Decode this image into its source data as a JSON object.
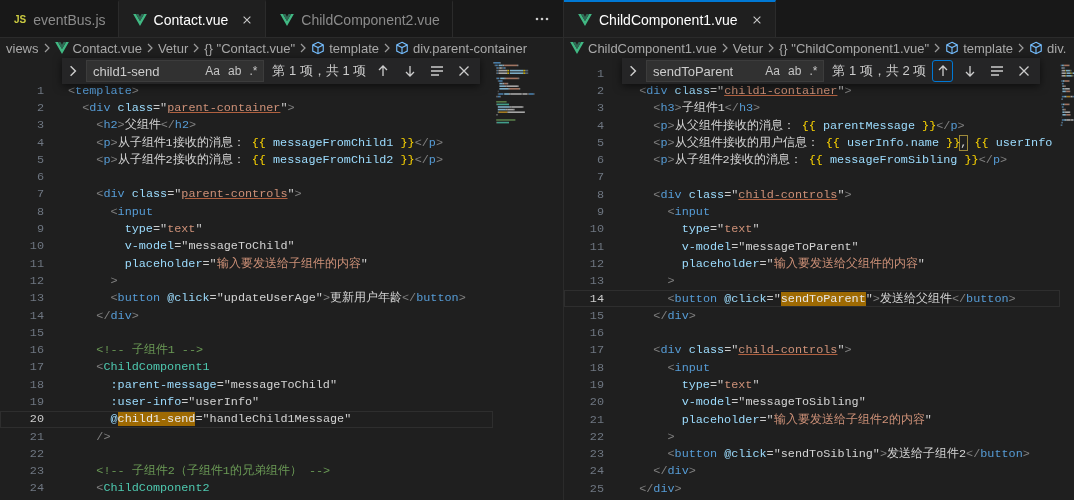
{
  "panes": [
    {
      "tabs": [
        {
          "label": "eventBus.js",
          "kind": "js",
          "icon_text": "JS",
          "selected": false
        },
        {
          "label": "Contact.vue",
          "kind": "vue",
          "selected": true
        },
        {
          "label": "ChildComponent2.vue",
          "kind": "vue",
          "selected": false
        }
      ],
      "breadcrumbs": [
        {
          "label": "views",
          "kind": "folder"
        },
        {
          "label": "Contact.vue",
          "kind": "file"
        },
        {
          "label": "Vetur",
          "kind": "text"
        },
        {
          "label": "{} \"Contact.vue\"",
          "kind": "object"
        },
        {
          "label": "template",
          "kind": "symbol"
        },
        {
          "label": "div.parent-container",
          "kind": "symbol"
        }
      ],
      "find": {
        "query": "child1-send",
        "toggles": [
          "Aa",
          "ab",
          ".*"
        ],
        "result": "第 1 项，共 1 项",
        "buttons": [
          {
            "kind": "previous",
            "focused": false
          },
          {
            "kind": "next",
            "focused": false
          },
          {
            "kind": "selection",
            "focused": false
          },
          {
            "kind": "close",
            "focused": false
          }
        ]
      },
      "lines": [
        {
          "number": "1",
          "current": false,
          "tokens": [
            {
              "kind": "p",
              "text": "<"
            },
            {
              "kind": "tag",
              "text": "template"
            },
            {
              "kind": "p",
              "text": ">"
            }
          ]
        },
        {
          "number": "2",
          "current": false,
          "tokens": [
            {
              "kind": "p",
              "text": "  <"
            },
            {
              "kind": "tag",
              "text": "div"
            },
            {
              "kind": "attr",
              "text": " class"
            },
            {
              "kind": "eq",
              "text": "=\""
            },
            {
              "kind": "cls",
              "text": "parent-container"
            },
            {
              "kind": "eq",
              "text": "\""
            },
            {
              "kind": "p",
              "text": ">"
            }
          ]
        },
        {
          "number": "3",
          "current": false,
          "tokens": [
            {
              "kind": "p",
              "text": "    <"
            },
            {
              "kind": "tag",
              "text": "h2"
            },
            {
              "kind": "p",
              "text": ">"
            },
            {
              "kind": "text",
              "text": "父组件"
            },
            {
              "kind": "p",
              "text": "</"
            },
            {
              "kind": "tag",
              "text": "h2"
            },
            {
              "kind": "p",
              "text": ">"
            }
          ]
        },
        {
          "number": "4",
          "current": false,
          "tokens": [
            {
              "kind": "p",
              "text": "    <"
            },
            {
              "kind": "tag",
              "text": "p"
            },
            {
              "kind": "p",
              "text": ">"
            },
            {
              "kind": "text",
              "text": "从子组件1接收的消息： "
            },
            {
              "kind": "br",
              "text": "{{"
            },
            {
              "kind": "var",
              "text": " messageFromChild1 "
            },
            {
              "kind": "br",
              "text": "}}"
            },
            {
              "kind": "p",
              "text": "</"
            },
            {
              "kind": "tag",
              "text": "p"
            },
            {
              "kind": "p",
              "text": ">"
            }
          ]
        },
        {
          "number": "5",
          "current": false,
          "tokens": [
            {
              "kind": "p",
              "text": "    <"
            },
            {
              "kind": "tag",
              "text": "p"
            },
            {
              "kind": "p",
              "text": ">"
            },
            {
              "kind": "text",
              "text": "从子组件2接收的消息： "
            },
            {
              "kind": "br",
              "text": "{{"
            },
            {
              "kind": "var",
              "text": " messageFromChild2 "
            },
            {
              "kind": "br",
              "text": "}}"
            },
            {
              "kind": "p",
              "text": "</"
            },
            {
              "kind": "tag",
              "text": "p"
            },
            {
              "kind": "p",
              "text": ">"
            }
          ]
        },
        {
          "number": "6",
          "current": false
        },
        {
          "number": "7",
          "current": false,
          "tokens": [
            {
              "kind": "p",
              "text": "    <"
            },
            {
              "kind": "tag",
              "text": "div"
            },
            {
              "kind": "attr",
              "text": " class"
            },
            {
              "kind": "eq",
              "text": "=\""
            },
            {
              "kind": "cls",
              "text": "parent-controls"
            },
            {
              "kind": "eq",
              "text": "\""
            },
            {
              "kind": "p",
              "text": ">"
            }
          ]
        },
        {
          "number": "8",
          "current": false,
          "tokens": [
            {
              "kind": "p",
              "text": "      <"
            },
            {
              "kind": "tag",
              "text": "input"
            }
          ]
        },
        {
          "number": "9",
          "current": false,
          "tokens": [
            {
              "kind": "attr",
              "text": "        type"
            },
            {
              "kind": "eq",
              "text": "=\""
            },
            {
              "kind": "str",
              "text": "text"
            },
            {
              "kind": "eq",
              "text": "\""
            }
          ]
        },
        {
          "number": "10",
          "current": false,
          "tokens": [
            {
              "kind": "attr",
              "text": "        v-model"
            },
            {
              "kind": "eq",
              "text": "=\""
            },
            {
              "kind": "text",
              "text": "messageToChild"
            },
            {
              "kind": "eq",
              "text": "\""
            }
          ]
        },
        {
          "number": "11",
          "current": false,
          "tokens": [
            {
              "kind": "attr",
              "text": "        placeholder"
            },
            {
              "kind": "eq",
              "text": "=\""
            },
            {
              "kind": "str",
              "text": "输入要发送给子组件的内容"
            },
            {
              "kind": "eq",
              "text": "\""
            }
          ]
        },
        {
          "number": "12",
          "current": false,
          "tokens": [
            {
              "kind": "p",
              "text": "      >"
            }
          ]
        },
        {
          "number": "13",
          "current": false,
          "tokens": [
            {
              "kind": "p",
              "text": "      <"
            },
            {
              "kind": "tag",
              "text": "button"
            },
            {
              "kind": "attr",
              "text": " @click"
            },
            {
              "kind": "eq",
              "text": "=\""
            },
            {
              "kind": "text",
              "text": "updateUserAge"
            },
            {
              "kind": "eq",
              "text": "\""
            },
            {
              "kind": "p",
              "text": ">"
            },
            {
              "kind": "text",
              "text": "更新用户年龄"
            },
            {
              "kind": "p",
              "text": "</"
            },
            {
              "kind": "tag",
              "text": "button"
            },
            {
              "kind": "p",
              "text": ">"
            }
          ]
        },
        {
          "number": "14",
          "current": false,
          "tokens": [
            {
              "kind": "p",
              "text": "    </"
            },
            {
              "kind": "tag",
              "text": "div"
            },
            {
              "kind": "p",
              "text": ">"
            }
          ]
        },
        {
          "number": "15",
          "current": false
        },
        {
          "number": "16",
          "current": false,
          "tokens": [
            {
              "kind": "com",
              "text": "    <!-- 子组件1 -->"
            }
          ]
        },
        {
          "number": "17",
          "current": false,
          "tokens": [
            {
              "kind": "p",
              "text": "    <"
            },
            {
              "kind": "comp",
              "text": "ChildComponent1"
            }
          ]
        },
        {
          "number": "18",
          "current": false,
          "tokens": [
            {
              "kind": "attr",
              "text": "      :parent-message"
            },
            {
              "kind": "eq",
              "text": "=\""
            },
            {
              "kind": "text",
              "text": "messageToChild"
            },
            {
              "kind": "eq",
              "text": "\""
            }
          ]
        },
        {
          "number": "19",
          "current": false,
          "tokens": [
            {
              "kind": "attr",
              "text": "      :user-info"
            },
            {
              "kind": "eq",
              "text": "=\""
            },
            {
              "kind": "text",
              "text": "userInfo"
            },
            {
              "kind": "eq",
              "text": "\""
            }
          ]
        },
        {
          "number": "20",
          "current": true,
          "tokens": [
            {
              "kind": "attr",
              "text": "      @"
            },
            {
              "kind": "match",
              "text": "child1-send"
            },
            {
              "kind": "eq",
              "text": "=\""
            },
            {
              "kind": "text",
              "text": "handleChild1Message"
            },
            {
              "kind": "eq",
              "text": "\""
            }
          ]
        },
        {
          "number": "21",
          "current": false,
          "tokens": [
            {
              "kind": "p",
              "text": "    />"
            }
          ]
        },
        {
          "number": "22",
          "current": false
        },
        {
          "number": "23",
          "current": false,
          "tokens": [
            {
              "kind": "com",
              "text": "    <!-- 子组件2（子组件1的兄弟组件） -->"
            }
          ]
        },
        {
          "number": "24",
          "current": false,
          "tokens": [
            {
              "kind": "p",
              "text": "    <"
            },
            {
              "kind": "comp",
              "text": "ChildComponent2"
            }
          ]
        }
      ]
    },
    {
      "tabs": [
        {
          "label": "ChildComponent1.vue",
          "kind": "vue",
          "selected": true
        }
      ],
      "breadcrumbs": [
        {
          "label": "ChildComponent1.vue",
          "kind": "file"
        },
        {
          "label": "Vetur",
          "kind": "text"
        },
        {
          "label": "{} \"ChildComponent1.vue\"",
          "kind": "object"
        },
        {
          "label": "template",
          "kind": "symbol"
        },
        {
          "label": "div.",
          "kind": "symbol"
        }
      ],
      "find": {
        "query": "sendToParent",
        "toggles": [
          "Aa",
          "ab",
          ".*"
        ],
        "result": "第 1 项，共 2 项",
        "buttons": [
          {
            "kind": "previous",
            "focused": true
          },
          {
            "kind": "next",
            "focused": false
          },
          {
            "kind": "selection",
            "focused": false
          },
          {
            "kind": "close",
            "focused": false
          }
        ]
      },
      "lines": [
        {
          "number": "1",
          "current": false
        },
        {
          "number": "2",
          "current": false,
          "tokens": [
            {
              "kind": "p",
              "text": "  <"
            },
            {
              "kind": "tag",
              "text": "div"
            },
            {
              "kind": "attr",
              "text": " class"
            },
            {
              "kind": "eq",
              "text": "=\""
            },
            {
              "kind": "cls",
              "text": "child1-container"
            },
            {
              "kind": "eq",
              "text": "\""
            },
            {
              "kind": "p",
              "text": ">"
            }
          ]
        },
        {
          "number": "3",
          "current": false,
          "tokens": [
            {
              "kind": "p",
              "text": "    <"
            },
            {
              "kind": "tag",
              "text": "h3"
            },
            {
              "kind": "p",
              "text": ">"
            },
            {
              "kind": "text",
              "text": "子组件1"
            },
            {
              "kind": "p",
              "text": "</"
            },
            {
              "kind": "tag",
              "text": "h3"
            },
            {
              "kind": "p",
              "text": ">"
            }
          ]
        },
        {
          "number": "4",
          "current": false,
          "tokens": [
            {
              "kind": "p",
              "text": "    <"
            },
            {
              "kind": "tag",
              "text": "p"
            },
            {
              "kind": "p",
              "text": ">"
            },
            {
              "kind": "text",
              "text": "从父组件接收的消息： "
            },
            {
              "kind": "br",
              "text": "{{"
            },
            {
              "kind": "var",
              "text": " parentMessage "
            },
            {
              "kind": "br",
              "text": "}}"
            },
            {
              "kind": "p",
              "text": "</"
            },
            {
              "kind": "tag",
              "text": "p"
            },
            {
              "kind": "p",
              "text": ">"
            }
          ]
        },
        {
          "number": "5",
          "current": false,
          "tokens": [
            {
              "kind": "p",
              "text": "    <"
            },
            {
              "kind": "tag",
              "text": "p"
            },
            {
              "kind": "p",
              "text": ">"
            },
            {
              "kind": "text",
              "text": "从父组件接收的用户信息： "
            },
            {
              "kind": "br",
              "text": "{{"
            },
            {
              "kind": "var",
              "text": " userInfo.name "
            },
            {
              "kind": "br",
              "text": "}}"
            },
            {
              "kind": "boxed",
              "text": ","
            },
            {
              "kind": "br",
              "text": " {{"
            },
            {
              "kind": "var",
              "text": " userInfo"
            }
          ]
        },
        {
          "number": "6",
          "current": false,
          "tokens": [
            {
              "kind": "p",
              "text": "    <"
            },
            {
              "kind": "tag",
              "text": "p"
            },
            {
              "kind": "p",
              "text": ">"
            },
            {
              "kind": "text",
              "text": "从子组件2接收的消息： "
            },
            {
              "kind": "br",
              "text": "{{"
            },
            {
              "kind": "var",
              "text": " messageFromSibling "
            },
            {
              "kind": "br",
              "text": "}}"
            },
            {
              "kind": "p",
              "text": "</"
            },
            {
              "kind": "tag",
              "text": "p"
            },
            {
              "kind": "p",
              "text": ">"
            }
          ]
        },
        {
          "number": "7",
          "current": false
        },
        {
          "number": "8",
          "current": false,
          "tokens": [
            {
              "kind": "p",
              "text": "    <"
            },
            {
              "kind": "tag",
              "text": "div"
            },
            {
              "kind": "attr",
              "text": " class"
            },
            {
              "kind": "eq",
              "text": "=\""
            },
            {
              "kind": "cls",
              "text": "child-controls"
            },
            {
              "kind": "eq",
              "text": "\""
            },
            {
              "kind": "p",
              "text": ">"
            }
          ]
        },
        {
          "number": "9",
          "current": false,
          "tokens": [
            {
              "kind": "p",
              "text": "      <"
            },
            {
              "kind": "tag",
              "text": "input"
            }
          ]
        },
        {
          "number": "10",
          "current": false,
          "tokens": [
            {
              "kind": "attr",
              "text": "        type"
            },
            {
              "kind": "eq",
              "text": "=\""
            },
            {
              "kind": "str",
              "text": "text"
            },
            {
              "kind": "eq",
              "text": "\""
            }
          ]
        },
        {
          "number": "11",
          "current": false,
          "tokens": [
            {
              "kind": "attr",
              "text": "        v-model"
            },
            {
              "kind": "eq",
              "text": "=\""
            },
            {
              "kind": "text",
              "text": "messageToParent"
            },
            {
              "kind": "eq",
              "text": "\""
            }
          ]
        },
        {
          "number": "12",
          "current": false,
          "tokens": [
            {
              "kind": "attr",
              "text": "        placeholder"
            },
            {
              "kind": "eq",
              "text": "=\""
            },
            {
              "kind": "str",
              "text": "输入要发送给父组件的内容"
            },
            {
              "kind": "eq",
              "text": "\""
            }
          ]
        },
        {
          "number": "13",
          "current": false,
          "tokens": [
            {
              "kind": "p",
              "text": "      >"
            }
          ]
        },
        {
          "number": "14",
          "current": true,
          "tokens": [
            {
              "kind": "p",
              "text": "      <"
            },
            {
              "kind": "tag",
              "text": "button"
            },
            {
              "kind": "attr",
              "text": " @click"
            },
            {
              "kind": "eq",
              "text": "=\""
            },
            {
              "kind": "match",
              "text": "sendToParent"
            },
            {
              "kind": "eq",
              "text": "\""
            },
            {
              "kind": "p",
              "text": ">"
            },
            {
              "kind": "text",
              "text": "发送给父组件"
            },
            {
              "kind": "p",
              "text": "</"
            },
            {
              "kind": "tag",
              "text": "button"
            },
            {
              "kind": "p",
              "text": ">"
            }
          ]
        },
        {
          "number": "15",
          "current": false,
          "tokens": [
            {
              "kind": "p",
              "text": "    </"
            },
            {
              "kind": "tag",
              "text": "div"
            },
            {
              "kind": "p",
              "text": ">"
            }
          ]
        },
        {
          "number": "16",
          "current": false
        },
        {
          "number": "17",
          "current": false,
          "tokens": [
            {
              "kind": "p",
              "text": "    <"
            },
            {
              "kind": "tag",
              "text": "div"
            },
            {
              "kind": "attr",
              "text": " class"
            },
            {
              "kind": "eq",
              "text": "=\""
            },
            {
              "kind": "cls",
              "text": "child-controls"
            },
            {
              "kind": "eq",
              "text": "\""
            },
            {
              "kind": "p",
              "text": ">"
            }
          ]
        },
        {
          "number": "18",
          "current": false,
          "tokens": [
            {
              "kind": "p",
              "text": "      <"
            },
            {
              "kind": "tag",
              "text": "input"
            }
          ]
        },
        {
          "number": "19",
          "current": false,
          "tokens": [
            {
              "kind": "attr",
              "text": "        type"
            },
            {
              "kind": "eq",
              "text": "=\""
            },
            {
              "kind": "str",
              "text": "text"
            },
            {
              "kind": "eq",
              "text": "\""
            }
          ]
        },
        {
          "number": "20",
          "current": false,
          "tokens": [
            {
              "kind": "attr",
              "text": "        v-model"
            },
            {
              "kind": "eq",
              "text": "=\""
            },
            {
              "kind": "text",
              "text": "messageToSibling"
            },
            {
              "kind": "eq",
              "text": "\""
            }
          ]
        },
        {
          "number": "21",
          "current": false,
          "tokens": [
            {
              "kind": "attr",
              "text": "        placeholder"
            },
            {
              "kind": "eq",
              "text": "=\""
            },
            {
              "kind": "str",
              "text": "输入要发送给子组件2的内容"
            },
            {
              "kind": "eq",
              "text": "\""
            }
          ]
        },
        {
          "number": "22",
          "current": false,
          "tokens": [
            {
              "kind": "p",
              "text": "      >"
            }
          ]
        },
        {
          "number": "23",
          "current": false,
          "tokens": [
            {
              "kind": "p",
              "text": "      <"
            },
            {
              "kind": "tag",
              "text": "button"
            },
            {
              "kind": "attr",
              "text": " @click"
            },
            {
              "kind": "eq",
              "text": "=\""
            },
            {
              "kind": "text",
              "text": "sendToSibling"
            },
            {
              "kind": "eq",
              "text": "\""
            },
            {
              "kind": "p",
              "text": ">"
            },
            {
              "kind": "text",
              "text": "发送给子组件2"
            },
            {
              "kind": "p",
              "text": "</"
            },
            {
              "kind": "tag",
              "text": "button"
            },
            {
              "kind": "p",
              "text": ">"
            }
          ]
        },
        {
          "number": "24",
          "current": false,
          "tokens": [
            {
              "kind": "p",
              "text": "    </"
            },
            {
              "kind": "tag",
              "text": "div"
            },
            {
              "kind": "p",
              "text": ">"
            }
          ]
        },
        {
          "number": "25",
          "current": false,
          "tokens": [
            {
              "kind": "p",
              "text": "  </"
            },
            {
              "kind": "tag",
              "text": "div"
            },
            {
              "kind": "p",
              "text": ">"
            }
          ]
        }
      ]
    }
  ]
}
